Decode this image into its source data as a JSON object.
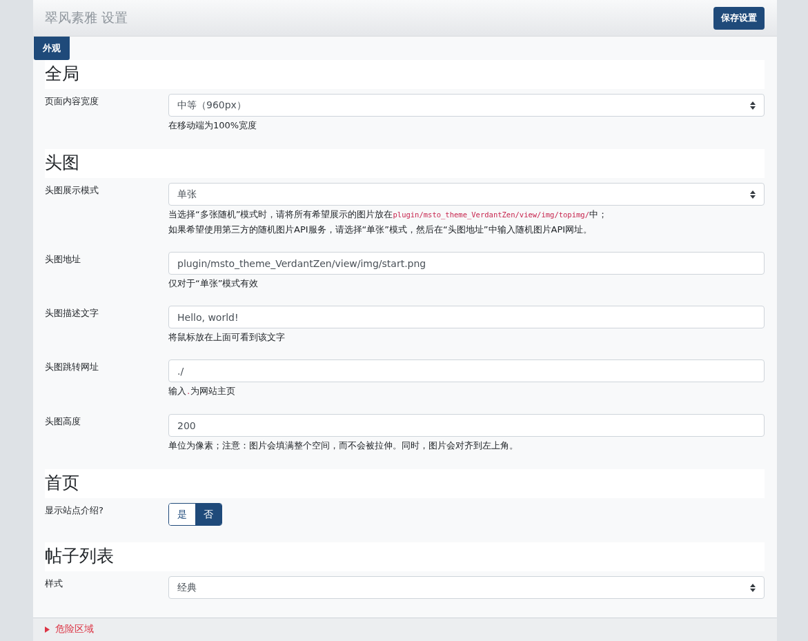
{
  "header": {
    "title": "翠风素雅 设置",
    "save_button": "保存设置"
  },
  "tabs": [
    {
      "label": "外观",
      "selected": true
    }
  ],
  "sections": [
    {
      "title": "全局",
      "fields": [
        {
          "kind": "select",
          "label": "页面内容宽度",
          "value": "中等（960px）",
          "help": [
            [
              {
                "kind": "text",
                "text": "在移动端为100%宽度"
              }
            ]
          ]
        }
      ]
    },
    {
      "title": "头图",
      "fields": [
        {
          "kind": "select",
          "label": "头图展示模式",
          "value": "单张",
          "help": [
            [
              {
                "kind": "text",
                "text": "当选择“多张随机”模式时，请将所有希望展示的图片放在"
              },
              {
                "kind": "code",
                "text": "plugin/msto_theme_VerdantZen/view/img/topimg/"
              },
              {
                "kind": "text",
                "text": "中；"
              }
            ],
            [
              {
                "kind": "text",
                "text": "如果希望使用第三方的随机图片API服务，请选择“单张”模式，然后在“头图地址”中输入随机图片API网址。"
              }
            ]
          ]
        },
        {
          "kind": "text",
          "label": "头图地址",
          "value": "plugin/msto_theme_VerdantZen/view/img/start.png",
          "help": [
            [
              {
                "kind": "text",
                "text": "仅对于“单张”模式有效"
              }
            ]
          ]
        },
        {
          "kind": "text",
          "label": "头图描述文字",
          "value": "Hello, world!",
          "help": [
            [
              {
                "kind": "text",
                "text": "将鼠标放在上面可看到该文字"
              }
            ]
          ]
        },
        {
          "kind": "text",
          "label": "头图跳转网址",
          "value": "./",
          "help": [
            [
              {
                "kind": "text",
                "text": "输入"
              },
              {
                "kind": "code",
                "text": "."
              },
              {
                "kind": "text",
                "text": "为网站主页"
              }
            ]
          ]
        },
        {
          "kind": "text",
          "label": "头图高度",
          "value": "200",
          "help": [
            [
              {
                "kind": "text",
                "text": "单位为像素；注意：图片会填满整个空间，而不会被拉伸。同时，图片会对齐到左上角。"
              }
            ]
          ]
        }
      ]
    },
    {
      "title": "首页",
      "fields": [
        {
          "kind": "toggle",
          "label": "显示站点介绍?",
          "options": [
            {
              "label": "是",
              "selected": false
            },
            {
              "label": "否",
              "selected": true
            }
          ]
        }
      ]
    },
    {
      "title": "帖子列表",
      "fields": [
        {
          "kind": "select",
          "label": "样式",
          "value": "经典"
        }
      ]
    }
  ],
  "danger_zone": {
    "label": "危险区域",
    "expanded": false
  }
}
